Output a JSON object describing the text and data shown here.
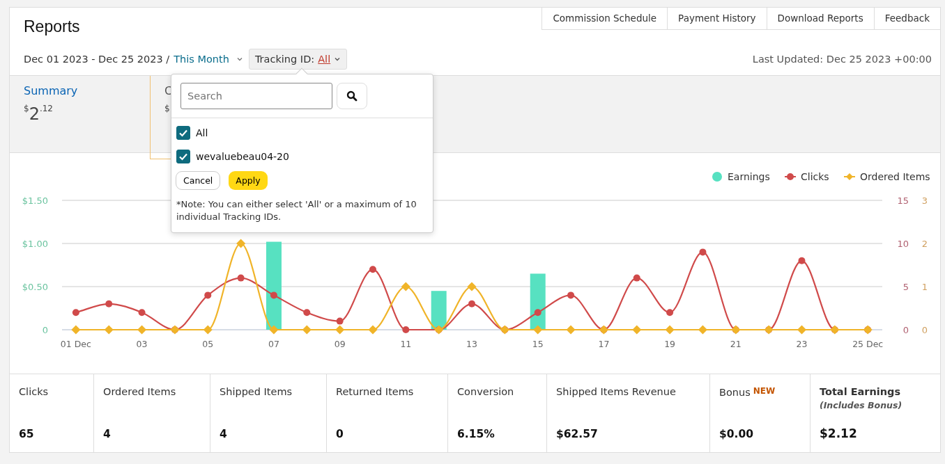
{
  "header": {
    "title": "Reports",
    "date_range": "Dec 01 2023 - Dec 25 2023 /",
    "period_link": "This Month",
    "tracking_label": "Tracking ID:",
    "tracking_value": "All",
    "last_updated": "Last Updated: Dec 25 2023 +00:00"
  },
  "nav_links": [
    "Commission Schedule",
    "Payment History",
    "Download Reports",
    "Feedback"
  ],
  "summary_cards": [
    {
      "title": "Summary",
      "currency": "$",
      "whole": "2",
      "cents": ".12",
      "selected": false
    },
    {
      "title": "C",
      "currency": "$",
      "selected": true
    }
  ],
  "tracking_popup": {
    "search_placeholder": "Search",
    "options": [
      {
        "label": "All",
        "checked": true
      },
      {
        "label": "wevaluebeau04-20",
        "checked": true
      }
    ],
    "cancel": "Cancel",
    "apply": "Apply",
    "note": "*Note: You can either select 'All' or a maximum of 10 individual Tracking IDs."
  },
  "chart": {
    "chart_data": {
      "type": "bar",
      "x": [
        1,
        2,
        3,
        4,
        5,
        6,
        7,
        8,
        9,
        10,
        11,
        12,
        13,
        14,
        15,
        16,
        17,
        18,
        19,
        20,
        21,
        22,
        23,
        24,
        25
      ],
      "xticks": [
        {
          "value": 1,
          "label": "01 Dec"
        },
        {
          "value": 3,
          "label": "03"
        },
        {
          "value": 5,
          "label": "05"
        },
        {
          "value": 7,
          "label": "07"
        },
        {
          "value": 9,
          "label": "09"
        },
        {
          "value": 11,
          "label": "11"
        },
        {
          "value": 13,
          "label": "13"
        },
        {
          "value": 15,
          "label": "15"
        },
        {
          "value": 17,
          "label": "17"
        },
        {
          "value": 19,
          "label": "19"
        },
        {
          "value": 21,
          "label": "21"
        },
        {
          "value": 23,
          "label": "23"
        },
        {
          "value": 25,
          "label": "25 Dec"
        }
      ],
      "yticks": [
        {
          "value": 0,
          "label": "0"
        },
        {
          "value": 0.5,
          "label": "$0.50"
        },
        {
          "value": 1,
          "label": "$1.00"
        },
        {
          "value": 1.5,
          "label": "$1.50"
        }
      ],
      "legend": "top-right",
      "xlim": [
        0.58,
        25.44
      ],
      "ylim": [
        0,
        1.5
      ],
      "y2lim": [
        0,
        15
      ],
      "y3lim": [
        0,
        3
      ],
      "y2ticks": [
        0,
        5,
        10,
        15
      ],
      "y3ticks": [
        0,
        1,
        2,
        3
      ],
      "series": [
        {
          "name": "Earnings",
          "type": "bar",
          "color": "#57e1c1",
          "values": [
            0,
            0,
            0,
            0,
            0,
            0,
            1.02,
            0,
            0,
            0,
            0,
            0.45,
            0,
            0,
            0.65,
            0,
            0,
            0,
            0,
            0,
            0,
            0,
            0,
            0,
            0
          ]
        },
        {
          "name": "Clicks",
          "type": "line",
          "axis": "y2",
          "marker": "circle",
          "color": "#d04a4a",
          "values": [
            2,
            3,
            2,
            0,
            4,
            6,
            4,
            2,
            1,
            7,
            0,
            0,
            3,
            0,
            2,
            4,
            0,
            6,
            2,
            9,
            0,
            0,
            8,
            0,
            0
          ]
        },
        {
          "name": "Ordered Items",
          "type": "line",
          "axis": "y3",
          "marker": "diamond",
          "color": "#f0b429",
          "values": [
            0,
            0,
            0,
            0,
            0,
            2,
            0,
            0,
            0,
            0,
            1,
            0,
            1,
            0,
            0,
            0,
            0,
            0,
            0,
            0,
            0,
            0,
            0,
            0,
            0
          ]
        }
      ]
    }
  },
  "stats": [
    {
      "label": "Clicks",
      "value": "65"
    },
    {
      "label": "Ordered Items",
      "value": "4"
    },
    {
      "label": "Shipped Items",
      "value": "4"
    },
    {
      "label": "Returned Items",
      "value": "0"
    },
    {
      "label": "Conversion",
      "value": "6.15%"
    },
    {
      "label": "Shipped Items Revenue",
      "value": "$62.57"
    },
    {
      "label": "Bonus",
      "badge": "NEW",
      "value": "$0.00"
    },
    {
      "label": "Total Earnings",
      "sublabel": "(Includes Bonus)",
      "value": "$2.12",
      "kind": "total"
    }
  ]
}
